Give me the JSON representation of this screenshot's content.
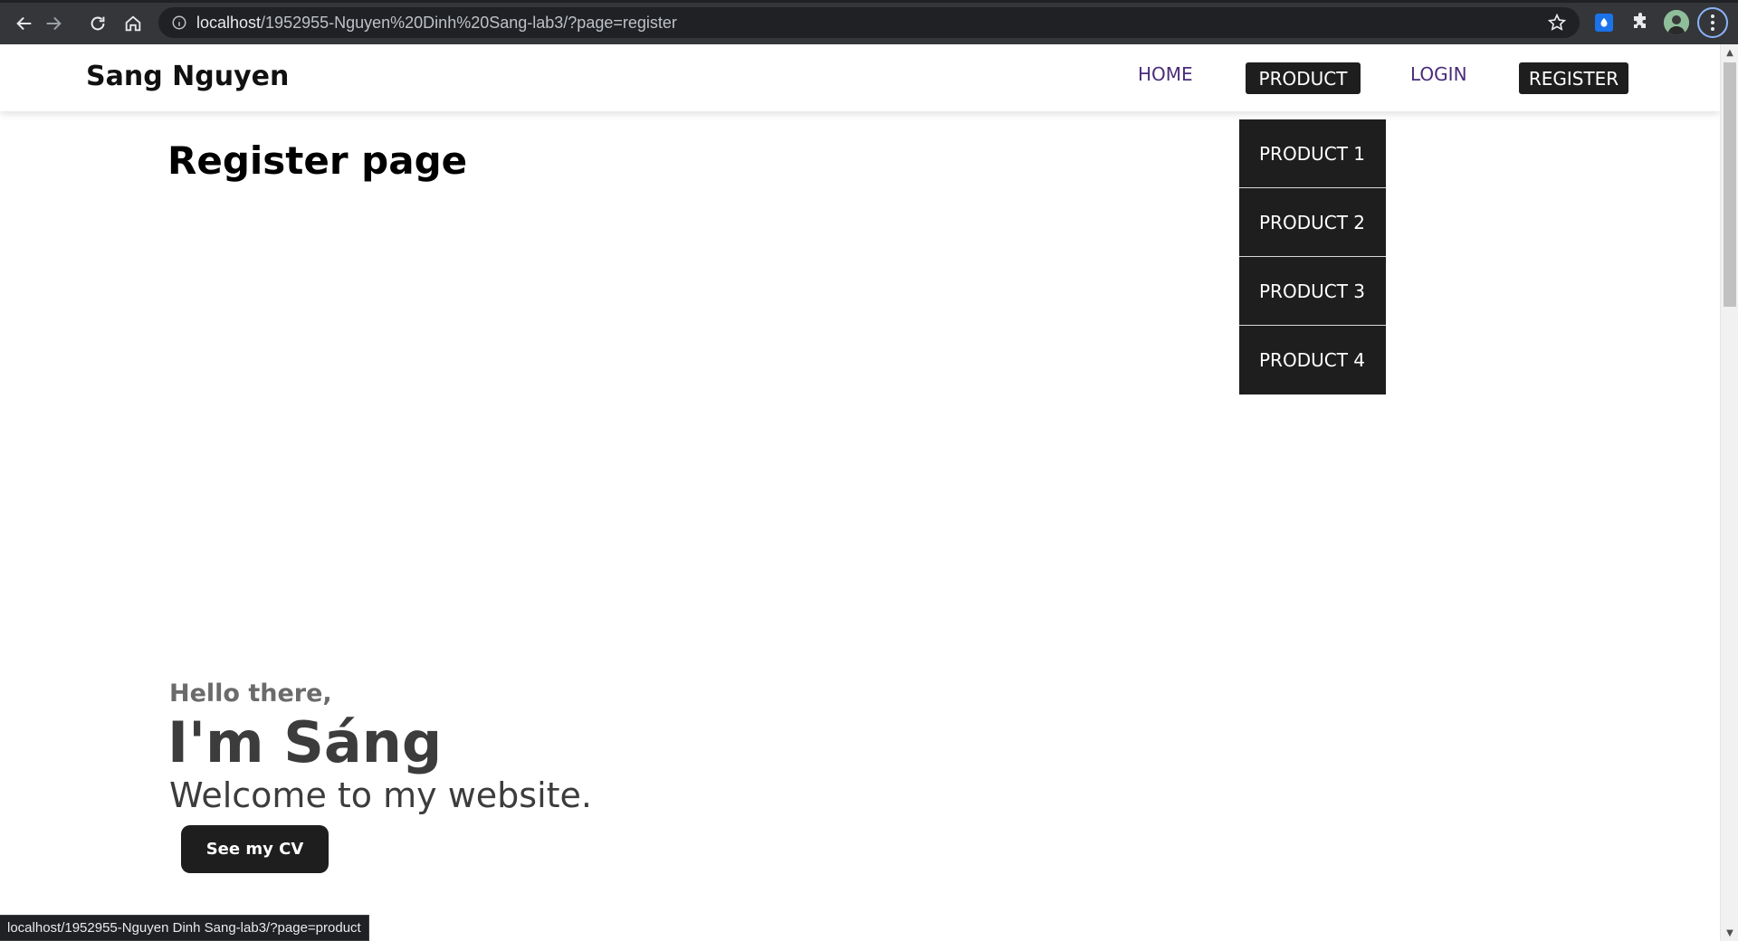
{
  "browser": {
    "url_host": "localhost",
    "url_path": "/1952955-Nguyen%20Dinh%20Sang-lab3/?page=register",
    "status_url": "localhost/1952955-Nguyen Dinh Sang-lab3/?page=product",
    "icons": {
      "back": "arrow-left-icon",
      "forward": "arrow-right-icon",
      "reload": "reload-icon",
      "home": "home-icon",
      "info": "info-icon",
      "bookmark": "star-icon",
      "extension": "drop-icon",
      "extensions": "puzzle-icon",
      "menu": "kebab-menu-icon"
    },
    "accent": "#8ab4f8"
  },
  "site": {
    "brand": "Sang Nguyen",
    "nav": {
      "home": "HOME",
      "product": "PRODUCT",
      "login": "LOGIN",
      "register": "REGISTER"
    },
    "dropdown": [
      "PRODUCT 1",
      "PRODUCT 2",
      "PRODUCT 3",
      "PRODUCT 4"
    ],
    "colors": {
      "dark": "#1e1e1e",
      "nav_text": "#4a2c7a"
    }
  },
  "main": {
    "title": "Register page",
    "hero": {
      "greeting": "Hello there,",
      "name": "I'm Sáng",
      "welcome": "Welcome to my website.",
      "cta": "See my CV"
    }
  }
}
